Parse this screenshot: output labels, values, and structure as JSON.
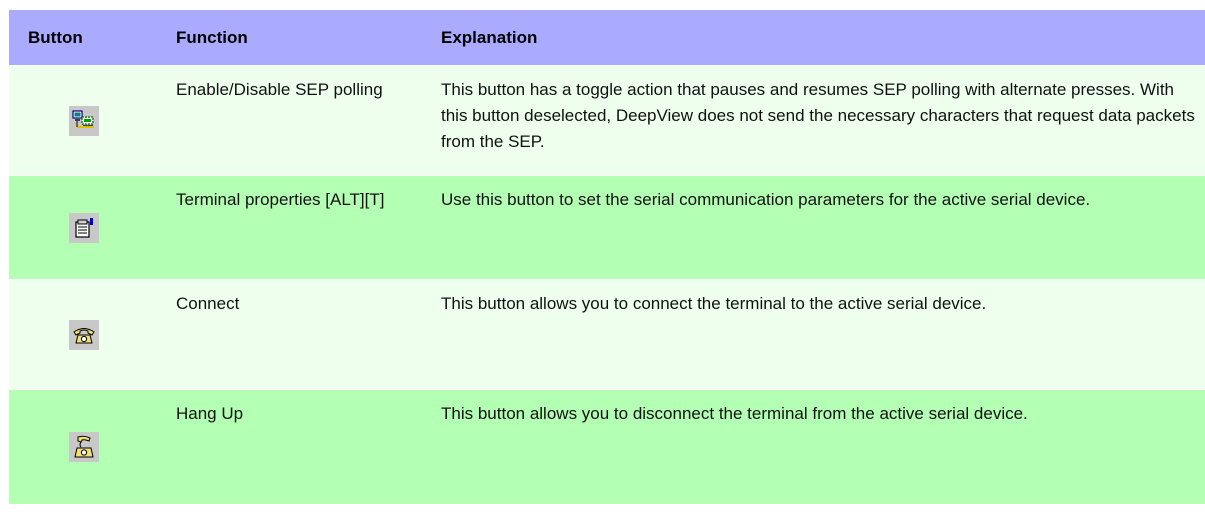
{
  "table": {
    "headers": {
      "button": "Button",
      "function": "Function",
      "explanation": "Explanation"
    },
    "rows": [
      {
        "icon": "network-polling-icon",
        "function": "Enable/Disable SEP polling",
        "explanation": "This button has a toggle action that pauses and resumes SEP polling with alternate presses. With this button deselected, DeepView does not send the necessary characters that request data packets from the SEP."
      },
      {
        "icon": "properties-icon",
        "function": "Terminal properties [ALT][T]",
        "explanation": "Use this button to set the serial communication parameters for the active serial device."
      },
      {
        "icon": "phone-connect-icon",
        "function": "Connect",
        "explanation": "This button allows you to connect the terminal to the active serial device."
      },
      {
        "icon": "phone-hangup-icon",
        "function": "Hang Up",
        "explanation": "This button allows you to disconnect the terminal from the active serial device."
      }
    ]
  },
  "colors": {
    "header_bg": "#aaaaff",
    "row_light": "#eeffee",
    "row_green": "#b3ffb3"
  }
}
